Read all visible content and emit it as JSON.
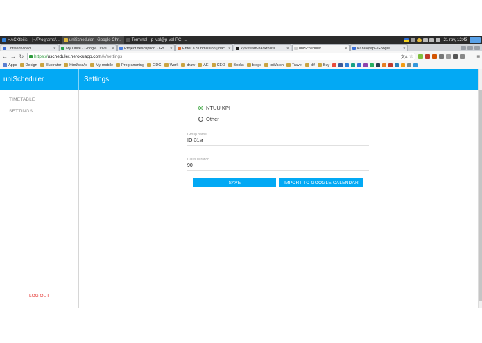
{
  "os": {
    "taskbar_items": [
      {
        "label": "HACKtbilisi - [~/Programs/...",
        "active": false,
        "color": "#2f7ed8"
      },
      {
        "label": "uniScheduler - Google Chr...",
        "active": true,
        "color": "#e2b93b"
      },
      {
        "label": "Terminal - p_val@p-val-PC: ...",
        "active": false,
        "color": "#555555"
      }
    ],
    "clock": "21 гру, 12:43"
  },
  "browser": {
    "tabs": [
      {
        "title": "Untitled video",
        "color": "#3b6cd6",
        "active": false
      },
      {
        "title": "My Drive - Google Drive",
        "color": "#2ba24c",
        "active": false
      },
      {
        "title": "Project description - Go",
        "color": "#4a7fe0",
        "active": false
      },
      {
        "title": "Enter a Submission | hac",
        "color": "#e06a2b",
        "active": false
      },
      {
        "title": "kyiv-team-hacktbilisi",
        "color": "#222222",
        "active": false
      },
      {
        "title": "uniScheduler",
        "color": "#cccccc",
        "active": true
      },
      {
        "title": "Календарь Google",
        "color": "#3a6fd8",
        "active": false
      }
    ],
    "url": {
      "scheme": "https://",
      "host": "uscheduler.herokuapp.com",
      "path": "/#/settings"
    },
    "bookmarks": {
      "apps_label": "Apps",
      "folders": [
        "Design",
        "Illustrator",
        "html/css/js",
        "My mobile",
        "Programming",
        "GDG",
        "Work",
        "draw",
        "AE",
        "CEO",
        "Books",
        "blogs",
        "toWatch",
        "Travel",
        "dif",
        "Buy"
      ]
    }
  },
  "app": {
    "title": "uniScheduler",
    "page_title": "Settings",
    "nav": {
      "timetable": "TIMETABLE",
      "settings": "SETTINGS",
      "logout": "LOG OUT"
    },
    "settings": {
      "university_options": [
        {
          "label": "NTUU KPI",
          "checked": true
        },
        {
          "label": "Other",
          "checked": false
        }
      ],
      "group_name_label": "Group name",
      "group_name_value": "ІО-31м",
      "class_duration_label": "Class duration",
      "class_duration_value": "90",
      "save_label": "SAVE",
      "import_label": "IMPORT TO GOOGLE CALENDAR"
    },
    "colors": {
      "primary": "#03a9f4",
      "accent": "#4caf50",
      "logout": "#e53935"
    }
  }
}
